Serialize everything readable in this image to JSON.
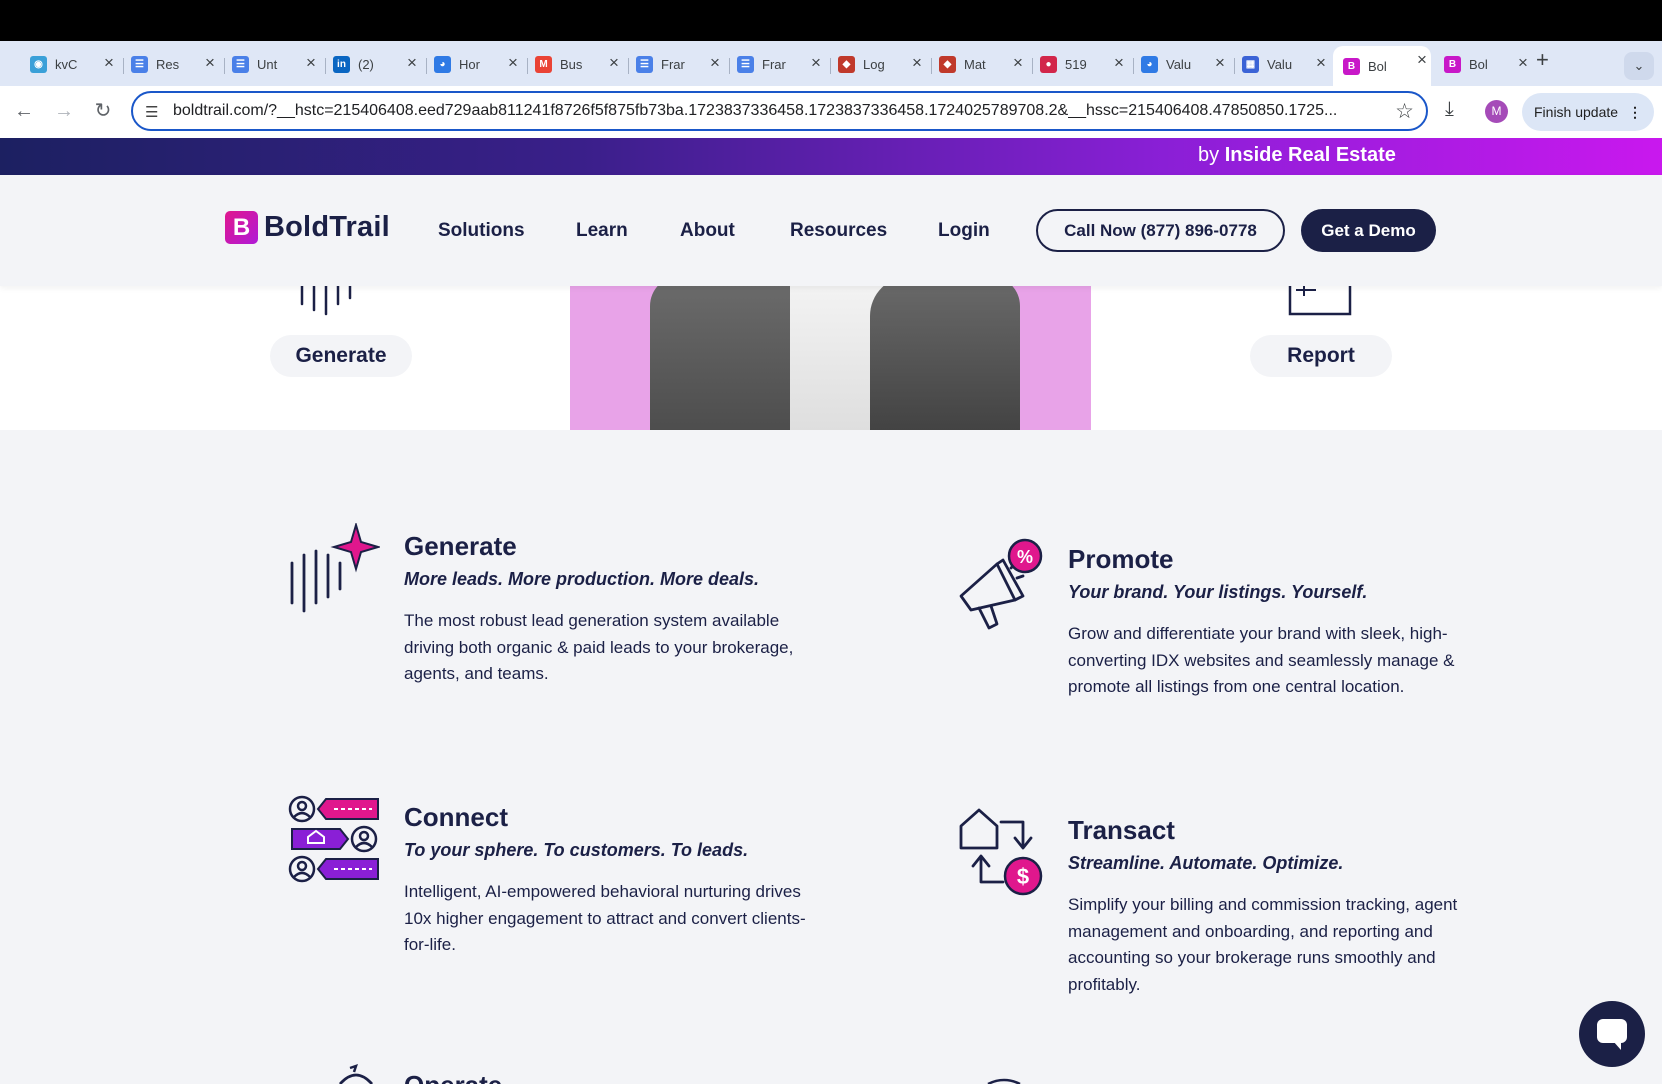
{
  "browser": {
    "tabs": [
      {
        "label": "kvC",
        "icon": "camera-icon",
        "color": "#3aa0d8"
      },
      {
        "label": "Res",
        "icon": "docs-icon",
        "color": "#4a80e8"
      },
      {
        "label": "Unt",
        "icon": "docs-icon",
        "color": "#4a80e8"
      },
      {
        "label": "(2)",
        "icon": "linkedin-icon",
        "color": "#0a66c2"
      },
      {
        "label": "Hor",
        "icon": "compass-icon",
        "color": "#2f7ae5"
      },
      {
        "label": "Bus",
        "icon": "gmail-icon",
        "color": "#ea4335"
      },
      {
        "label": "Frar",
        "icon": "docs-icon",
        "color": "#4a80e8"
      },
      {
        "label": "Frar",
        "icon": "docs-icon",
        "color": "#4a80e8"
      },
      {
        "label": "Log",
        "icon": "box-icon",
        "color": "#c0392b"
      },
      {
        "label": "Mat",
        "icon": "box-icon",
        "color": "#c0392b"
      },
      {
        "label": "519",
        "icon": "bug-icon",
        "color": "#d2264a"
      },
      {
        "label": "Valu",
        "icon": "compass-icon",
        "color": "#2f7ae5"
      },
      {
        "label": "Valu",
        "icon": "printer-icon",
        "color": "#3b63d6"
      },
      {
        "label": "Bol",
        "icon": "boldtrail-icon",
        "color": "#c818c8"
      },
      {
        "label": "Bol",
        "icon": "boldtrail-icon",
        "color": "#c818c8"
      }
    ],
    "active_tab_index": 13,
    "url": "boldtrail.com/?__hstc=215406408.eed729aab811241f8726f5f875fb73ba.1723837336458.1723837336458.1724025789708.2&__hssc=215406408.47850850.1725...",
    "profile_initial": "M",
    "finish_update_label": "Finish update"
  },
  "site": {
    "promo": {
      "by": "by",
      "brand": "Inside Real Estate"
    },
    "logo_text": "BoldTrail",
    "logo_letter": "B",
    "nav": [
      "Solutions",
      "Learn",
      "About",
      "Resources",
      "Login"
    ],
    "call_button": "Call Now (877) 896-0778",
    "demo_button": "Get a Demo",
    "hero_pills": {
      "left": "Generate",
      "right": "Report"
    },
    "features": [
      {
        "title": "Generate",
        "tagline": "More leads. More production. More deals.",
        "description": "The most robust lead generation system available driving both organic & paid leads to your brokerage, agents, and teams.",
        "icon": "sparkle-lines-icon"
      },
      {
        "title": "Promote",
        "tagline": "Your brand. Your listings. Yourself.",
        "description": "Grow and differentiate your brand with sleek, high-converting IDX websites and seamlessly manage & promote all listings from one central location.",
        "icon": "megaphone-icon"
      },
      {
        "title": "Connect",
        "tagline": "To your sphere. To customers. To leads.",
        "description": "Intelligent, AI-empowered behavioral nurturing drives 10x higher engagement to attract and convert clients-for-life.",
        "icon": "chat-network-icon"
      },
      {
        "title": "Transact",
        "tagline": "Streamline. Automate. Optimize.",
        "description": "Simplify your billing and commission tracking, agent management and onboarding, and reporting and accounting so your brokerage runs smoothly and profitably.",
        "icon": "house-dollar-icon"
      }
    ],
    "partial_title": "Operate"
  },
  "colors": {
    "navy": "#1b2046",
    "magenta": "#e0178d",
    "purple": "#8a1fd6",
    "background": "#f3f4f7"
  }
}
